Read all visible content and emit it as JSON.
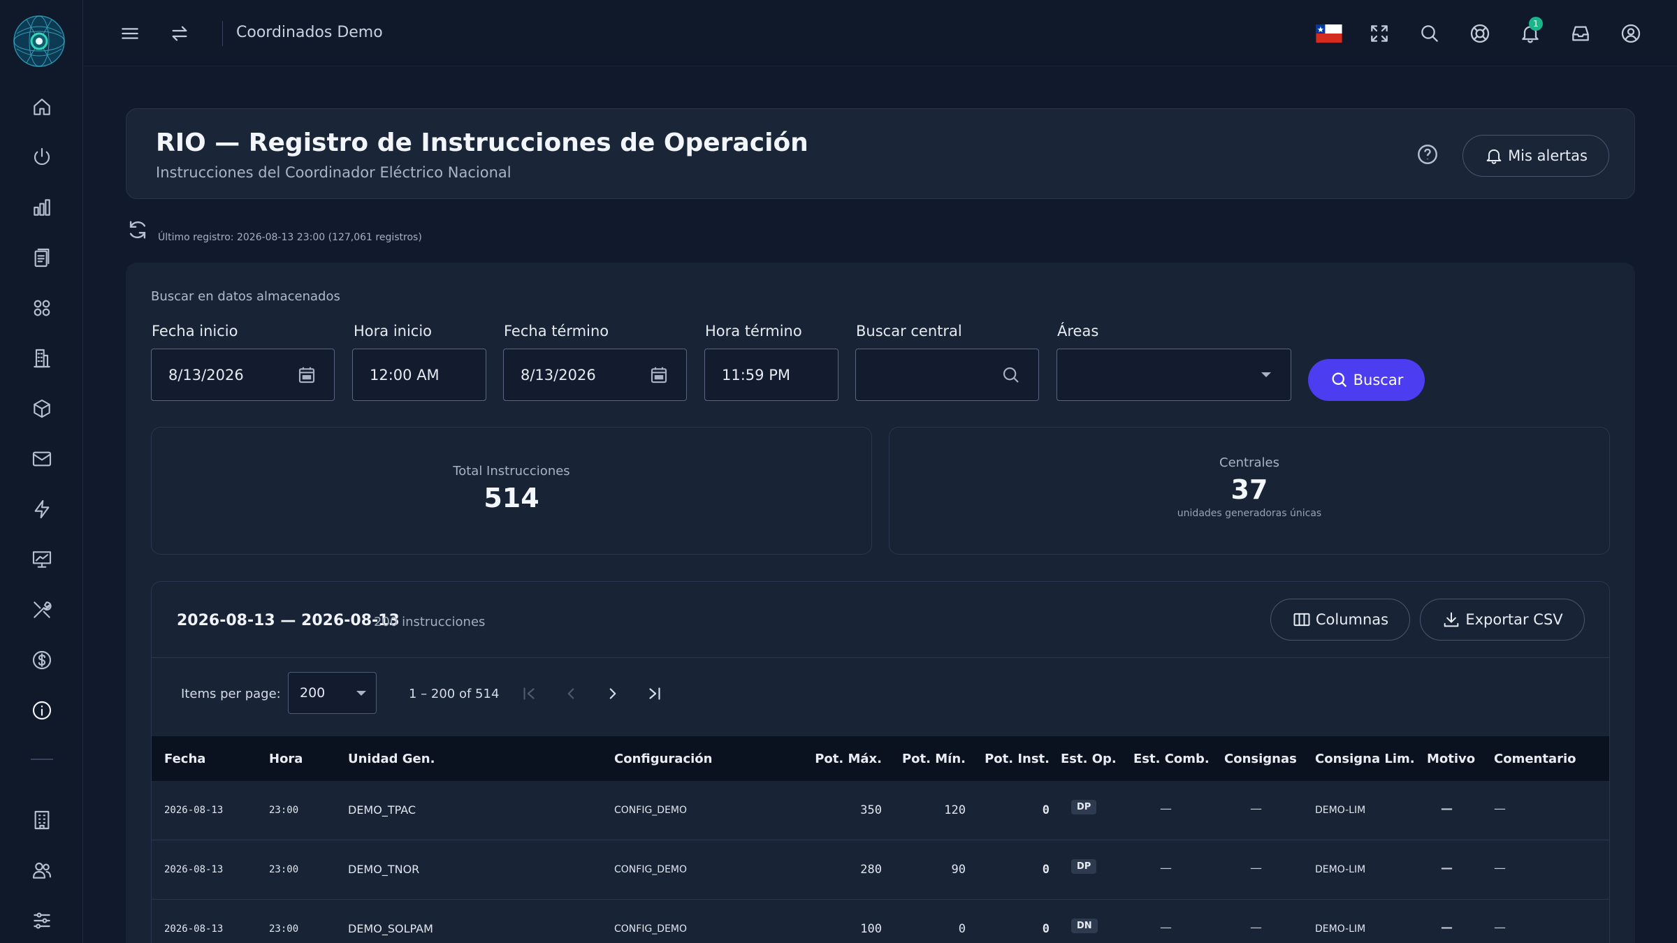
{
  "topbar": {
    "title": "Coordinados Demo",
    "notification_count": "1",
    "icons": [
      "menu-icon",
      "swap-icon",
      "chile-flag-icon",
      "fullscreen-icon",
      "search-icon",
      "help-buoy-icon",
      "bell-icon",
      "inbox-icon",
      "user-icon"
    ]
  },
  "sidebar": {
    "items": [
      "home-icon",
      "power-icon",
      "bar-chart-icon",
      "clipboard-icon",
      "grid-icon",
      "building-icon",
      "cube-icon",
      "mail-icon",
      "lightning-icon",
      "presentation-chart-icon",
      "tools-icon",
      "dollar-icon",
      "info-icon",
      "office-building-icon",
      "users-icon",
      "sliders-icon"
    ]
  },
  "header": {
    "title": "RIO — Registro de Instrucciones de Operación",
    "subtitle": "Instrucciones del Coordinador Eléctrico Nacional",
    "alerts_button": "Mis alertas"
  },
  "last_record": "Último registro: 2026-08-13 23:00 (127,061 registros)",
  "search": {
    "section_label": "Buscar en datos almacenados",
    "fecha_inicio_label": "Fecha inicio",
    "fecha_inicio_value": "8/13/2026",
    "hora_inicio_label": "Hora inicio",
    "hora_inicio_value": "12:00  AM",
    "fecha_termino_label": "Fecha término",
    "fecha_termino_value": "8/13/2026",
    "hora_termino_label": "Hora término",
    "hora_termino_value": "11:59  PM",
    "central_label": "Buscar central",
    "central_value": "",
    "areas_label": "Áreas",
    "areas_value": "",
    "button": "Buscar"
  },
  "stats": {
    "total_label": "Total Instrucciones",
    "total_value": "514",
    "centrales_label": "Centrales",
    "centrales_value": "37",
    "centrales_note": "unidades generadoras únicas"
  },
  "results": {
    "range_title": "2026-08-13 — 2026-08-13",
    "range_count": "200 instrucciones",
    "columns_button": "Columnas",
    "export_button": "Exportar CSV",
    "items_per_page_label": "Items per page:",
    "items_per_page_value": "200",
    "page_range": "1 – 200 of 514"
  },
  "table": {
    "headers": {
      "fecha": "Fecha",
      "hora": "Hora",
      "unidad": "Unidad Gen.",
      "config": "Configuración",
      "pot_max": "Pot. Máx.",
      "pot_min": "Pot. Mín.",
      "pot_inst": "Pot. Inst.",
      "est_op": "Est. Op.",
      "est_comb": "Est. Comb.",
      "consignas": "Consignas",
      "consigna_lim": "Consigna Lim.",
      "motivo": "Motivo",
      "comentario": "Comentario"
    },
    "rows": [
      {
        "fecha": "2026-08-13",
        "hora": "23:00",
        "unidad": "DEMO_TPAC",
        "config": "CONFIG_DEMO",
        "pot_max": "350",
        "pot_min": "120",
        "pot_inst": "0",
        "est_op": "DP",
        "est_comb": "—",
        "consignas": "—",
        "consigna_lim": "DEMO-LIM",
        "motivo": "—",
        "comentario": "—"
      },
      {
        "fecha": "2026-08-13",
        "hora": "23:00",
        "unidad": "DEMO_TNOR",
        "config": "CONFIG_DEMO",
        "pot_max": "280",
        "pot_min": "90",
        "pot_inst": "0",
        "est_op": "DP",
        "est_comb": "—",
        "consignas": "—",
        "consigna_lim": "DEMO-LIM",
        "motivo": "—",
        "comentario": "—"
      },
      {
        "fecha": "2026-08-13",
        "hora": "23:00",
        "unidad": "DEMO_SOLPAM",
        "config": "CONFIG_DEMO",
        "pot_max": "100",
        "pot_min": "0",
        "pot_inst": "0",
        "est_op": "DN",
        "est_comb": "—",
        "consignas": "—",
        "consigna_lim": "DEMO-LIM",
        "motivo": "—",
        "comentario": "—"
      }
    ]
  },
  "colors": {
    "background": "#101a2c",
    "panel": "#192336",
    "primary": "#4d3df0",
    "badge": "#1bb58a"
  }
}
